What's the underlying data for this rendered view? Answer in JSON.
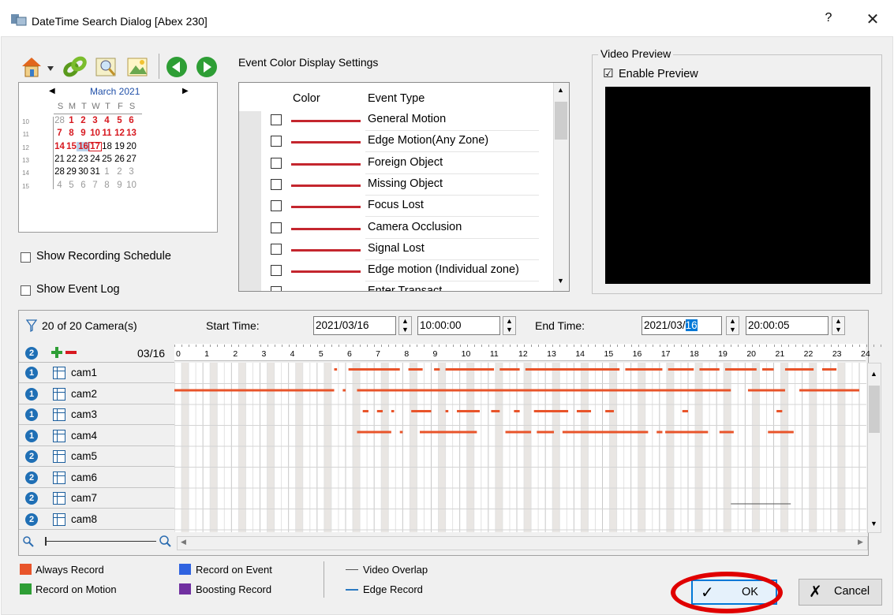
{
  "window": {
    "title": "DateTime Search Dialog [Abex 230]",
    "help_label": "?",
    "close_label": "✕"
  },
  "calendar": {
    "month_label": "March 2021",
    "weekday_labels": [
      "S",
      "M",
      "T",
      "W",
      "T",
      "F",
      "S"
    ],
    "weeks": [
      {
        "week": "10",
        "days": [
          "28",
          "1",
          "2",
          "3",
          "4",
          "5",
          "6"
        ]
      },
      {
        "week": "11",
        "days": [
          "7",
          "8",
          "9",
          "10",
          "11",
          "12",
          "13"
        ]
      },
      {
        "week": "12",
        "days": [
          "14",
          "15",
          "16",
          "17",
          "18",
          "19",
          "20"
        ]
      },
      {
        "week": "13",
        "days": [
          "21",
          "22",
          "23",
          "24",
          "25",
          "26",
          "27"
        ]
      },
      {
        "week": "14",
        "days": [
          "28",
          "29",
          "30",
          "31",
          "1",
          "2",
          "3"
        ]
      },
      {
        "week": "15",
        "days": [
          "4",
          "5",
          "6",
          "7",
          "8",
          "9",
          "10"
        ]
      }
    ]
  },
  "options": {
    "show_recording_schedule": "Show Recording Schedule",
    "show_event_log": "Show Event Log"
  },
  "event_settings": {
    "heading": "Event Color Display Settings",
    "col_color": "Color",
    "col_event_type": "Event Type",
    "events": [
      "General Motion",
      "Edge Motion(Any Zone)",
      "Foreign Object",
      "Missing Object",
      "Focus Lost",
      "Camera Occlusion",
      "Signal Lost",
      "Edge motion (Individual zone)",
      "Enter Transact"
    ],
    "line_color": "#c4262e"
  },
  "video_preview": {
    "group_label": "Video Preview",
    "enable_label": "Enable Preview",
    "enable_checked": "☑"
  },
  "timeline": {
    "camera_count": "20 of 20 Camera(s)",
    "start_label": "Start Time:",
    "start_date": "2021/03/16",
    "start_time": "10:00:00",
    "end_label": "End Time:",
    "end_date_prefix": "2021/03/",
    "end_date_day": "16",
    "end_time": "20:00:05",
    "group_badge": "2",
    "date_label": "03/16",
    "hours": [
      "0",
      "1",
      "2",
      "3",
      "4",
      "5",
      "6",
      "7",
      "8",
      "9",
      "10",
      "11",
      "12",
      "13",
      "14",
      "15",
      "16",
      "17",
      "18",
      "19",
      "20",
      "21",
      "22",
      "23",
      "24"
    ],
    "cameras": [
      {
        "name": "cam1",
        "badge": "1"
      },
      {
        "name": "cam2",
        "badge": "1"
      },
      {
        "name": "cam3",
        "badge": "1"
      },
      {
        "name": "cam4",
        "badge": "1"
      },
      {
        "name": "cam5",
        "badge": "2"
      },
      {
        "name": "cam6",
        "badge": "2"
      },
      {
        "name": "cam7",
        "badge": "2"
      },
      {
        "name": "cam8",
        "badge": "2"
      }
    ]
  },
  "legend": {
    "always_record": "Always Record",
    "record_on_motion": "Record on Motion",
    "record_on_event": "Record on Event",
    "boosting_record": "Boosting Record",
    "video_overlap": "Video Overlap",
    "edge_record": "Edge Record",
    "colors": {
      "always": "#e8542a",
      "motion": "#2e9e35",
      "event": "#2f63e0",
      "boosting": "#7030a0",
      "edge": "#2b79c2"
    }
  },
  "buttons": {
    "ok": "OK",
    "cancel": "Cancel"
  }
}
